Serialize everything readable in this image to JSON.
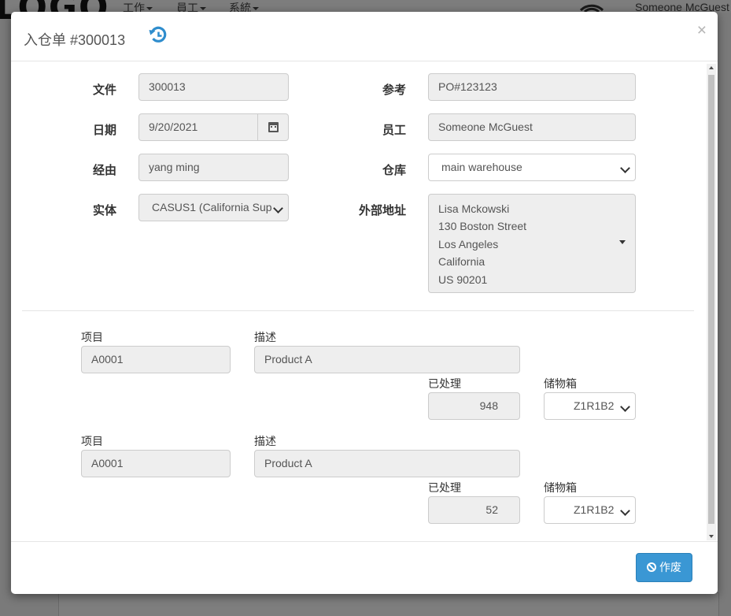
{
  "background": {
    "logo": "LOGO",
    "menu": [
      "工作",
      "員工",
      "系統"
    ],
    "user": "Someone McGuest"
  },
  "modal": {
    "title": "入仓单 #300013",
    "history_icon": "history-icon",
    "close_label": "×"
  },
  "form": {
    "document": {
      "label": "文件",
      "value": "300013"
    },
    "reference": {
      "label": "参考",
      "value": "PO#123123"
    },
    "date": {
      "label": "日期",
      "value": "9/20/2021",
      "icon": "calendar-icon"
    },
    "employee": {
      "label": "员工",
      "value": "Someone McGuest"
    },
    "handled_by": {
      "label": "经由",
      "value": "yang ming"
    },
    "warehouse": {
      "label": "仓库",
      "value": "main warehouse"
    },
    "entity": {
      "label": "实体",
      "value": "CASUS1 (California Sup"
    },
    "external_address": {
      "label": "外部地址",
      "lines": [
        "Lisa Mckowski",
        "130 Boston Street",
        "Los Angeles",
        "California",
        "US 90201"
      ]
    }
  },
  "items": [
    {
      "item_label": "项目",
      "item": "A0001",
      "desc_label": "描述",
      "description": "Product A",
      "processed_label": "已处理",
      "processed": "948",
      "bin_label": "储物箱",
      "bin": "Z1R1B2"
    },
    {
      "item_label": "项目",
      "item": "A0001",
      "desc_label": "描述",
      "description": "Product A",
      "processed_label": "已处理",
      "processed": "52",
      "bin_label": "储物箱",
      "bin": "Z1R1B2"
    }
  ],
  "footer": {
    "void_label": "作废",
    "void_icon": "ban-icon",
    "accent": "#3a97d4"
  }
}
